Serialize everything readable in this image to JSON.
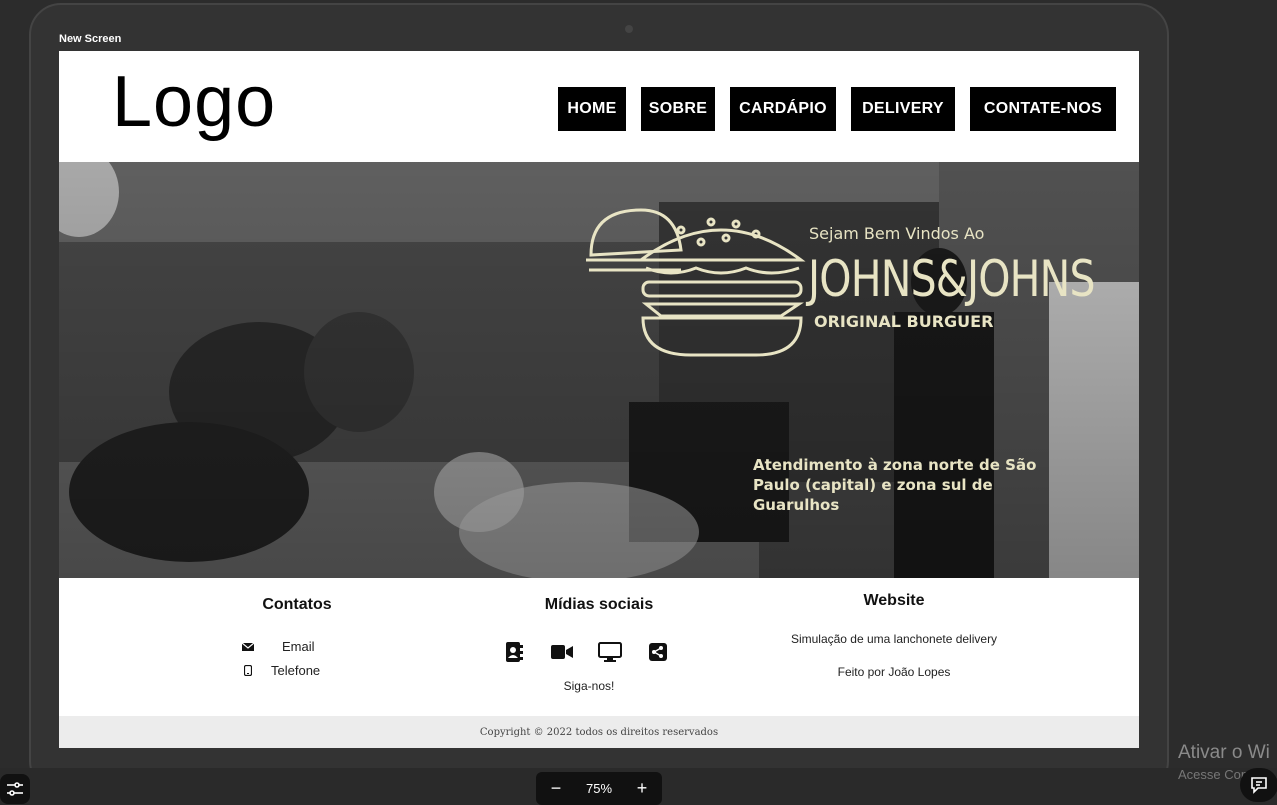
{
  "window": {
    "screen_label": "New Screen"
  },
  "header": {
    "logo_text": "Logo",
    "nav": [
      {
        "label": "HOME"
      },
      {
        "label": "SOBRE"
      },
      {
        "label": "CARDÁPIO"
      },
      {
        "label": "DELIVERY"
      },
      {
        "label": "CONTATE-NOS"
      }
    ]
  },
  "hero": {
    "welcome": "Sejam Bem Vindos Ao",
    "brand": "JOHNS&JOHNS",
    "subtitle": "ORIGINAL BURGUER",
    "service": "Atendimento à zona norte de São Paulo (capital) e zona sul de Guarulhos",
    "accent_color": "#e8e4c4"
  },
  "footer": {
    "contatos": {
      "title": "Contatos",
      "email": "Email",
      "telefone": "Telefone"
    },
    "midias": {
      "title": "Mídias sociais",
      "icons": [
        "contact-book-icon",
        "video-camera-icon",
        "monitor-icon",
        "share-icon"
      ],
      "follow": "Siga-nos!"
    },
    "website": {
      "title": "Website",
      "description": "Simulação de uma lanchonete delivery",
      "author": "Feito por João Lopes"
    },
    "copyright": "Copyright © 2022 todos os direitos reservados"
  },
  "toolbar": {
    "zoom": "75%",
    "zoom_out": "−",
    "zoom_in": "+"
  },
  "windows_watermark": {
    "line1": "Ativar o Wi",
    "line2": "Acesse Config"
  }
}
